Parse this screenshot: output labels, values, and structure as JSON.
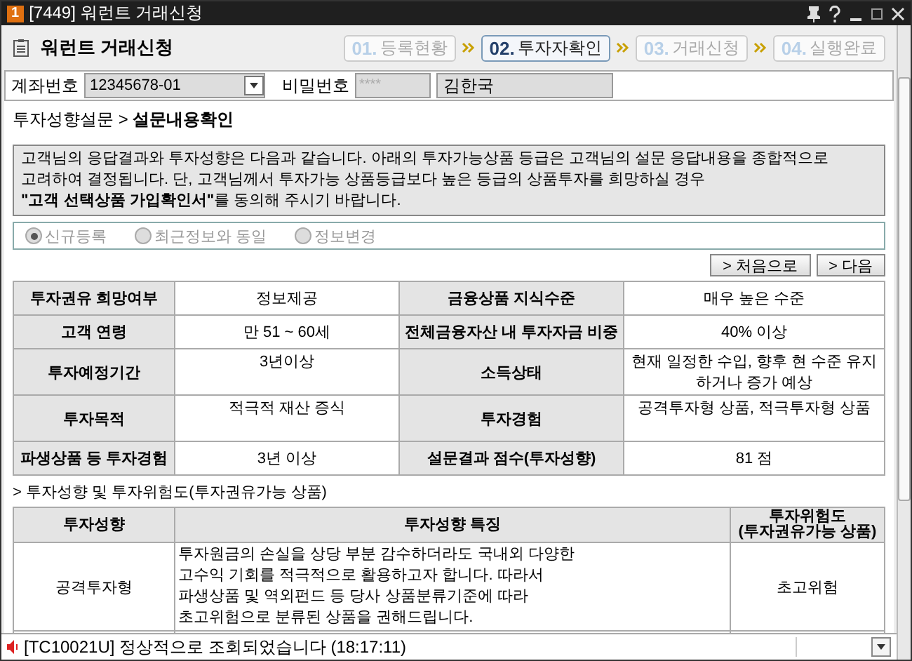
{
  "window": {
    "badge": "1",
    "title": "[7449] 워런트 거래신청"
  },
  "header": {
    "title": "워런트 거래신청",
    "steps": [
      {
        "num": "01.",
        "label": "등록현황",
        "selected": false
      },
      {
        "num": "02.",
        "label": "투자자확인",
        "selected": true
      },
      {
        "num": "03.",
        "label": "거래신청",
        "selected": false
      },
      {
        "num": "04.",
        "label": "실행완료",
        "selected": false
      }
    ]
  },
  "account": {
    "label": "계좌번호",
    "value": "12345678-01",
    "password_label": "비밀번호",
    "password": "****",
    "name": "김한국"
  },
  "breadcrumb": {
    "parent": "투자성향설문 >",
    "current": "설문내용확인"
  },
  "notice": "고객님의 응답결과와 투자성향은 다음과 같습니다. 아래의 투자가능상품 등급은 고객님의 설문 응답내용을 종합적으로\n고려하여 결정됩니다. 단, 고객님께서 투자가능 상품등급보다 높은 등급의 상품투자를 희망하실 경우\n**\"고객 선택상품 가입확인서\"**를 동의해 주시기 바랍니다.",
  "radios": [
    {
      "label": "신규등록",
      "selected": true,
      "disabled": true
    },
    {
      "label": "최근정보와 동일",
      "selected": false,
      "disabled": true
    },
    {
      "label": "정보변경",
      "selected": false,
      "disabled": true
    }
  ],
  "buttons": [
    "> 처음으로",
    "> 다음"
  ],
  "summary": [
    [
      "투자권유 희망여부",
      "정보제공",
      "금융상품 지식수준",
      "매우 높은 수준"
    ],
    [
      "고객 연령",
      "만 51 ~ 60세",
      "전체금융자산 내 투자자금 비중",
      "40% 이상"
    ],
    [
      "투자예정기간",
      "3년이상",
      "소득상태",
      "현재 일정한 수입, 향후 현 수준 유지하거나 증가 예상"
    ],
    [
      "투자목적",
      "적극적 재산 증식",
      "투자경험",
      "공격투자형 상품, 적극투자형 상품"
    ],
    [
      "파생상품 등 투자경험",
      "3년 이상",
      "설문결과 점수(투자성향)",
      "81 점"
    ]
  ],
  "section_title": "> 투자성향 및 투자위험도(투자권유가능 상품)",
  "risk_table": {
    "columns": [
      "투자성향",
      "투자성향 특징",
      "투자위험도\n(투자권유가능 상품)"
    ],
    "rows": [
      [
        "공격투자형",
        "투자원금의 손실을 상당 부분 감수하더라도 국내외 다양한\n고수익 기회를 적극적으로 활용하고자 합니다. 따라서\n파생상품 및 역외펀드 등 당사 상품분류기준에 따라\n초고위험으로 분류된 상품을 권해드립니다.",
        "초고위험"
      ]
    ]
  },
  "status_bar": {
    "message": "[TC10021U] 정상적으로 조회되었습니다 (18:17:11)"
  }
}
